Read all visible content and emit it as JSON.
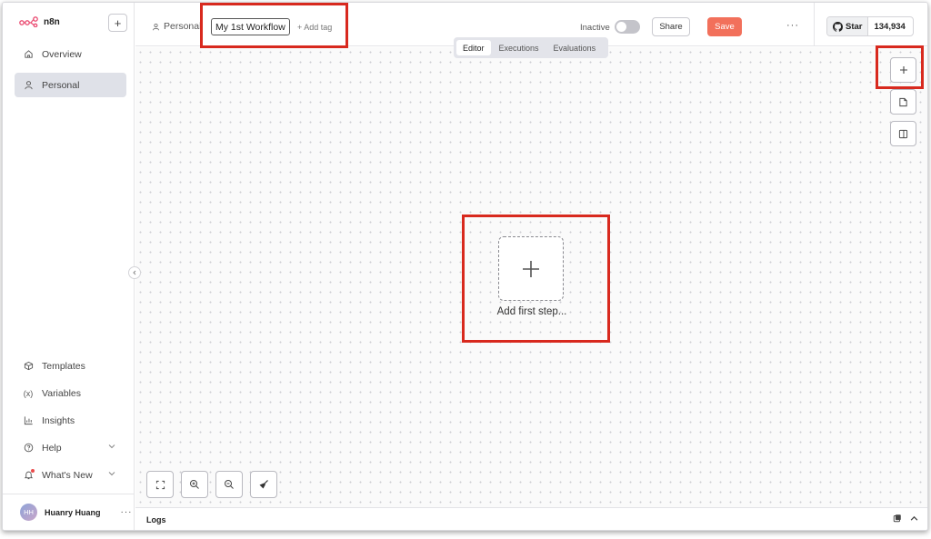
{
  "app": {
    "name": "n8n"
  },
  "sidebar": {
    "top_items": [
      {
        "label": "Overview",
        "icon": "home-icon"
      },
      {
        "label": "Personal",
        "icon": "user-icon",
        "active": true
      }
    ],
    "bottom_items": [
      {
        "label": "Templates",
        "icon": "box-icon"
      },
      {
        "label": "Variables",
        "icon": "variable-icon"
      },
      {
        "label": "Insights",
        "icon": "chart-icon"
      },
      {
        "label": "Help",
        "icon": "help-icon"
      },
      {
        "label": "What's New",
        "icon": "bell-icon"
      }
    ],
    "user": {
      "initials": "HH",
      "name": "Huanry Huang"
    }
  },
  "header": {
    "breadcrumb": "Personal",
    "workflow_name": "My 1st Workflow",
    "add_tag": "+ Add tag",
    "status_label": "Inactive",
    "share_label": "Share",
    "save_label": "Save",
    "github": {
      "star_label": "Star",
      "count": "134,934"
    }
  },
  "tabs": [
    {
      "label": "Editor",
      "active": true
    },
    {
      "label": "Executions"
    },
    {
      "label": "Evaluations"
    }
  ],
  "canvas": {
    "add_first_step_label": "Add first step..."
  },
  "logs": {
    "label": "Logs"
  },
  "colors": {
    "accent": "#f2705b",
    "highlight": "#d8291e",
    "brand": "#ea4b71"
  }
}
